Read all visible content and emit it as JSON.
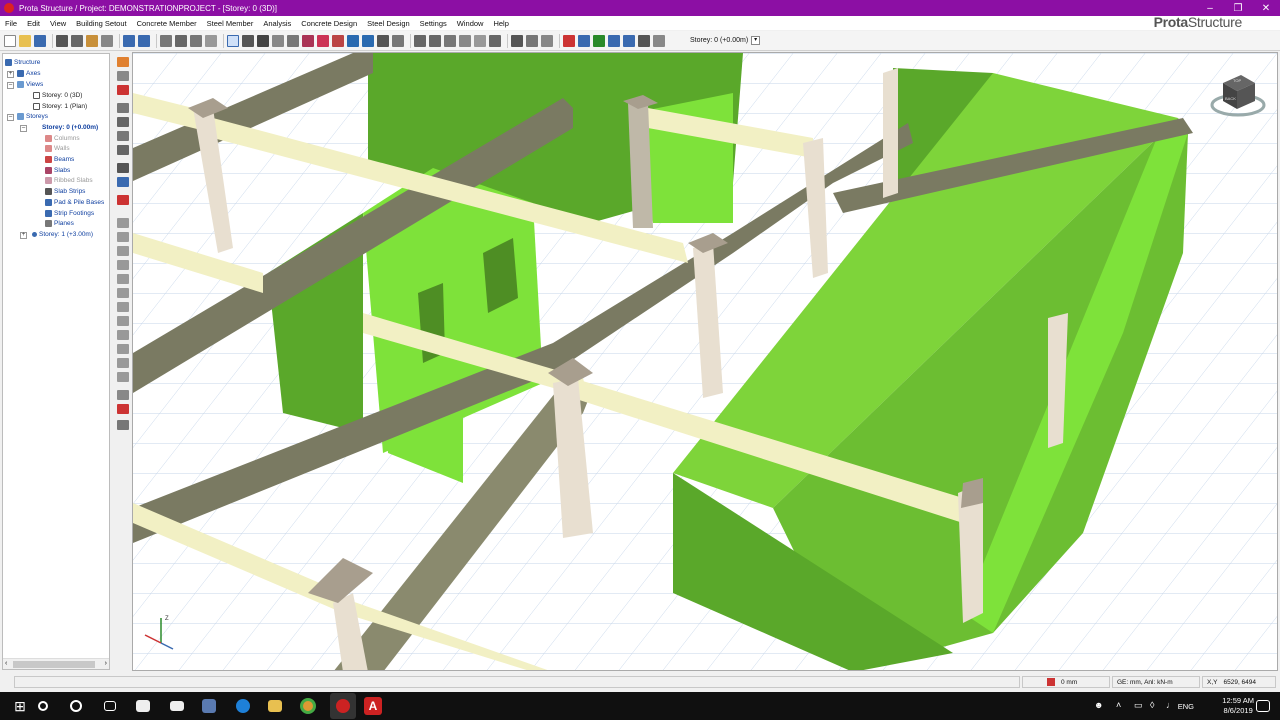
{
  "window": {
    "title": "Prota Structure / Project: DEMONSTRATIONPROJECT - [Storey: 0 (3D)]"
  },
  "brand": {
    "bold": "Prota",
    "rest": "Structure"
  },
  "menu": [
    "File",
    "Edit",
    "View",
    "Building Setout",
    "Concrete Member",
    "Steel Member",
    "Analysis",
    "Concrete Design",
    "Steel Design",
    "Settings",
    "Window",
    "Help"
  ],
  "toolbar": {
    "storey_label": "Storey: 0 (+0.00m)"
  },
  "tree": {
    "root": "Structure",
    "axes": "Axes",
    "views": "Views",
    "view_3d": "Storey: 0 (3D)",
    "view_plan": "Storey: 1 (Plan)",
    "storeys": "Storeys",
    "storey0": "Storey: 0 (+0.00m)",
    "items": [
      "Columns",
      "Walls",
      "Beams",
      "Slabs",
      "Ribbed Slabs",
      "Slab Strips",
      "Pad & Pile Bases",
      "Strip Footings",
      "Planes"
    ],
    "storey1": "Storey: 1 (+3.00m)"
  },
  "viewcube": {
    "face_top": "TOP",
    "face_back": "BACK"
  },
  "axis_triad": {
    "z": "Z"
  },
  "status": {
    "elevation": "0 mm",
    "units": "GE: mm, Anl: kN-m",
    "coord_label": "X,Y",
    "coords": "6529, 6494"
  },
  "taskbar": {
    "lang": "ENG",
    "time": "12:59 AM",
    "date": "8/6/2019"
  },
  "colors": {
    "title_bar": "#8c0fa4",
    "wall_light": "#7ee23a",
    "wall_dark": "#5aa82a",
    "beam_light": "#f2f0c4",
    "beam_dark": "#7a7a62",
    "column": "#bfb8a8"
  }
}
